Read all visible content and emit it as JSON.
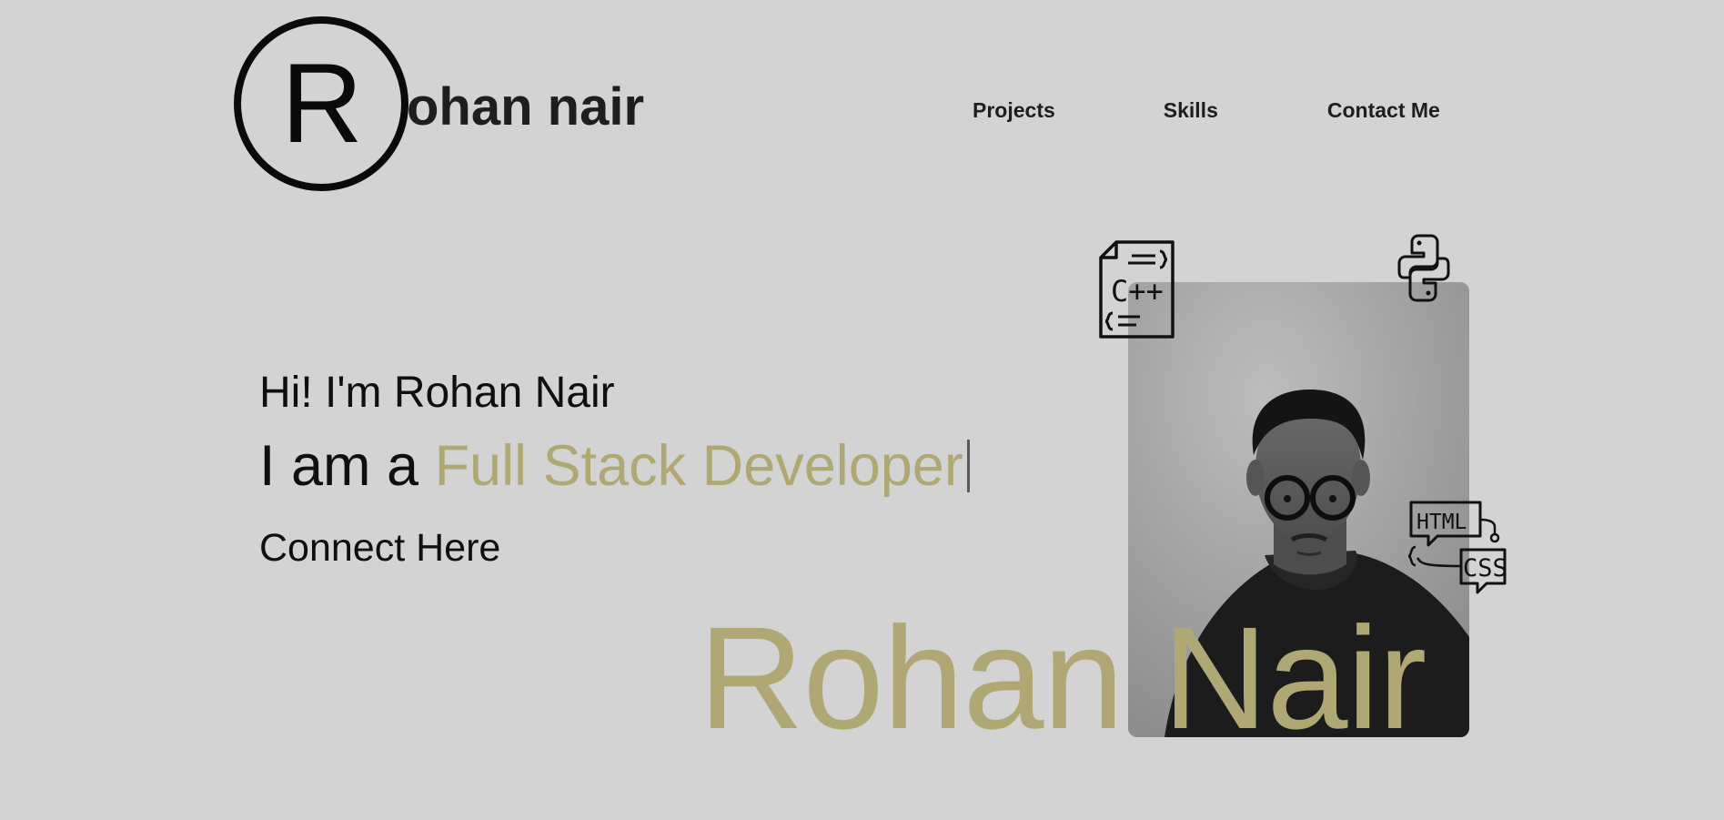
{
  "header": {
    "logo_letter": "R",
    "logo_rest": "ohan nair",
    "nav": {
      "projects": "Projects",
      "skills": "Skills",
      "contact": "Contact Me"
    }
  },
  "hero": {
    "greeting": "Hi! I'm Rohan Nair",
    "role_prefix": "I am a ",
    "role_highlight": "Full Stack Developer",
    "connect": "Connect Here",
    "big_name": "Rohan Nair"
  },
  "icons": {
    "cpp": {
      "name": "cpp-file-icon",
      "text": "C++"
    },
    "python": {
      "name": "python-icon"
    },
    "html_css": {
      "name": "html-css-icon",
      "html_text": "HTML",
      "css_text": "CSS"
    }
  },
  "photo": {
    "name": "profile-photo"
  },
  "colors": {
    "background": "#d3d3d3",
    "accent": "#b0a874",
    "text": "#0f0f0f"
  }
}
